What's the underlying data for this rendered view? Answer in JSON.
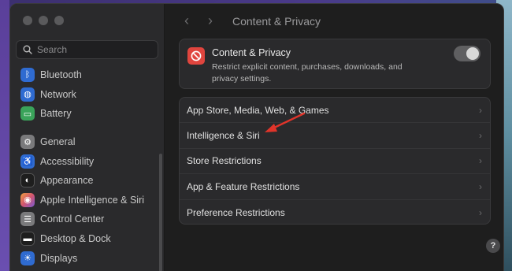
{
  "search": {
    "placeholder": "Search"
  },
  "sidebar": {
    "items": [
      {
        "label": "Bluetooth",
        "icon": "bluetooth-icon",
        "color": "#2f6bd1"
      },
      {
        "label": "Network",
        "icon": "globe-icon",
        "color": "#2f6bd1"
      },
      {
        "label": "Battery",
        "icon": "battery-icon",
        "color": "#3aa35a"
      },
      {
        "label": "General",
        "icon": "gear-icon",
        "color": "#7a7a7c"
      },
      {
        "label": "Accessibility",
        "icon": "accessibility-icon",
        "color": "#2f6bd1"
      },
      {
        "label": "Appearance",
        "icon": "appearance-icon",
        "color": "#1e1e1e"
      },
      {
        "label": "Apple Intelligence & Siri",
        "icon": "siri-icon",
        "color": "#d2556f"
      },
      {
        "label": "Control Center",
        "icon": "control-center-icon",
        "color": "#7a7a7c"
      },
      {
        "label": "Desktop & Dock",
        "icon": "dock-icon",
        "color": "#1e1e1e"
      },
      {
        "label": "Displays",
        "icon": "sun-icon",
        "color": "#2f6bd1"
      }
    ]
  },
  "header": {
    "title": "Content & Privacy"
  },
  "content_privacy": {
    "title": "Content & Privacy",
    "description": "Restrict explicit content, purchases, downloads, and privacy settings.",
    "enabled": true
  },
  "restrictions": {
    "rows": [
      {
        "label": "App Store, Media, Web, & Games"
      },
      {
        "label": "Intelligence & Siri"
      },
      {
        "label": "Store Restrictions"
      },
      {
        "label": "App & Feature Restrictions"
      },
      {
        "label": "Preference Restrictions"
      }
    ]
  },
  "help": {
    "label": "?"
  },
  "accent_colors": {
    "arrow": "#e0342a",
    "cp_icon": "#e0453e"
  }
}
